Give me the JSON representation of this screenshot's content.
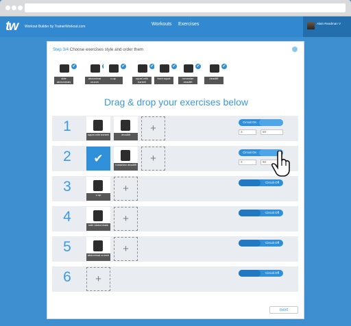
{
  "header": {
    "logo": "tw",
    "brand": "Workout Builder by TrainerWorkout.com",
    "nav": [
      "Workouts",
      "Exercises"
    ],
    "user": "Alain Readman V"
  },
  "step": {
    "prefix": "Step 3/4",
    "text": " Choose exercises style and order them"
  },
  "palette": [
    {
      "label": "side abdominals",
      "checked": true
    },
    {
      "label": "abdominal crunch",
      "checked": true
    },
    {
      "label": "v-up",
      "checked": true
    },
    {
      "label": "squat with barbell",
      "checked": true
    },
    {
      "label": "front squat",
      "checked": true
    },
    {
      "label": "romanian deadlift",
      "checked": true
    },
    {
      "label": "deadlift",
      "checked": true
    }
  ],
  "title": "Drag & drop your exercises below",
  "rows": [
    {
      "number": "1",
      "slots": [
        "squat with barbell",
        "deadlift"
      ],
      "circuit": "Circuit On",
      "on": true,
      "reps": "3",
      "rest": "60"
    },
    {
      "number": "2",
      "slots": [
        "selected",
        "romanian deadlift"
      ],
      "circuit": "Circuit On",
      "on": true,
      "reps": "3",
      "rest": "90"
    },
    {
      "number": "3",
      "slots": [
        "v-up"
      ],
      "circuit": "Circuit Off",
      "on": false
    },
    {
      "number": "4",
      "slots": [
        "side abdominals"
      ],
      "circuit": "Circuit Off",
      "on": false
    },
    {
      "number": "5",
      "slots": [
        "abdominal crunch"
      ],
      "circuit": "Circuit Off",
      "on": false
    },
    {
      "number": "6",
      "slots": [],
      "circuit": "Circuit Off",
      "on": false
    }
  ],
  "plus_symbol": "+",
  "check_symbol": "✔",
  "next": "next",
  "colors": {
    "accent": "#3b99df",
    "topbar": "#3389cf",
    "background": "#3d8fd0"
  }
}
